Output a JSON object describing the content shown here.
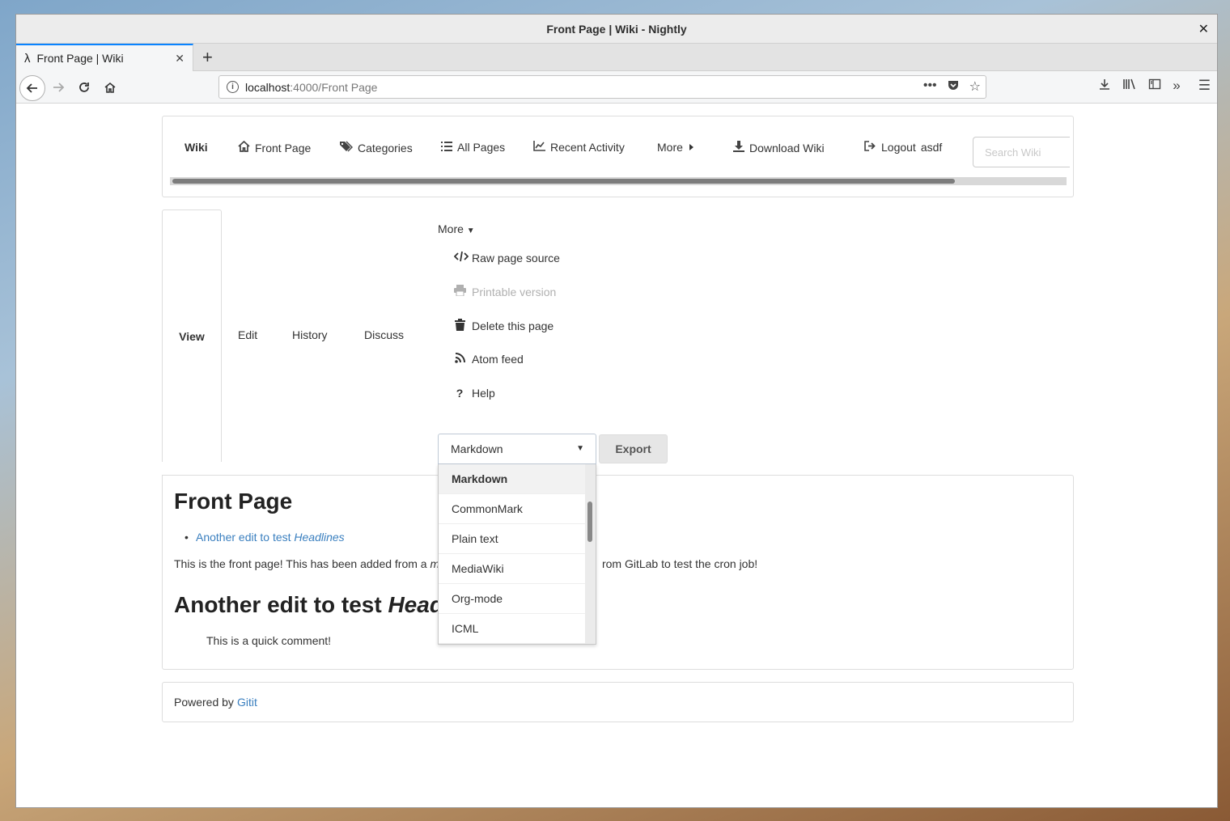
{
  "window": {
    "title": "Front Page | Wiki - Nightly",
    "close": "✕"
  },
  "tab": {
    "favicon": "λ",
    "label": "Front Page | Wiki",
    "close": "✕"
  },
  "newtab": "+",
  "url": {
    "host": "localhost",
    "path": ":4000/Front Page"
  },
  "toolbar_icons": [
    "download-icon",
    "library-icon",
    "sidebar-icon",
    "overflow-icon",
    "menu-icon"
  ],
  "nav": {
    "brand": "Wiki",
    "front_page": "Front Page",
    "categories": "Categories",
    "all_pages": "All Pages",
    "recent_activity": "Recent Activity",
    "more": "More",
    "download": "Download Wiki",
    "logout": "Logout",
    "user": "asdf",
    "search_placeholder": "Search Wiki"
  },
  "page_tabs": {
    "view": "View",
    "edit": "Edit",
    "history": "History",
    "discuss": "Discuss"
  },
  "more_menu": {
    "label": "More",
    "items": [
      {
        "label": "Raw page source",
        "icon": "code-icon",
        "disabled": false
      },
      {
        "label": "Printable version",
        "icon": "print-icon",
        "disabled": true
      },
      {
        "label": "Delete this page",
        "icon": "trash-icon",
        "disabled": false
      },
      {
        "label": "Atom feed",
        "icon": "rss-icon",
        "disabled": false
      },
      {
        "label": "Help",
        "icon": "question-icon",
        "disabled": false
      }
    ]
  },
  "export": {
    "selected": "Markdown",
    "button": "Export",
    "options": [
      "Markdown",
      "CommonMark",
      "Plain text",
      "MediaWiki",
      "Org-mode",
      "ICML"
    ]
  },
  "article": {
    "title": "Front Page",
    "toc_link_prefix": "Another edit to test ",
    "toc_link_em": "Headlines",
    "para_start": "This is the front page! This has been added from a ",
    "para_em": "mo",
    "para_end": "rom GitLab to test the cron job!",
    "h2_prefix": "Another edit to test ",
    "h2_em": "Headli",
    "quote": "This is a quick comment!"
  },
  "footer": {
    "text": "Powered by",
    "link": "Gitit"
  },
  "colors": {
    "link": "#3a7fbf",
    "tab_accent": "#0a84ff"
  }
}
